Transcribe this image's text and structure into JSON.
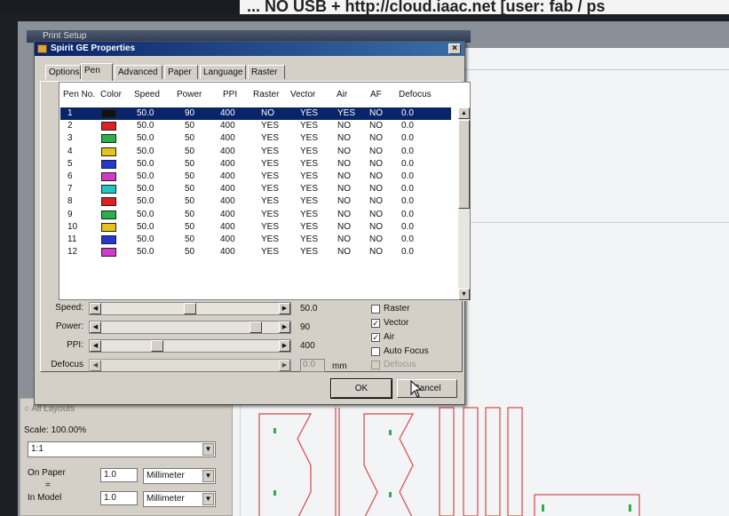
{
  "top_strip": {
    "text": "... NO USB + http://cloud.iaac.net [user: fab / ps"
  },
  "print_setup": {
    "title": "Print Setup"
  },
  "dialog": {
    "title": "Spirit GE Properties",
    "close_symbol": "×",
    "tabs": [
      {
        "label": "Options",
        "active": false
      },
      {
        "label": "Pen",
        "active": true
      },
      {
        "label": "Advanced",
        "active": false
      },
      {
        "label": "Paper",
        "active": false
      },
      {
        "label": "Language",
        "active": false
      },
      {
        "label": "Raster",
        "active": false
      }
    ],
    "table": {
      "headers": [
        "Pen No.",
        "Color",
        "Speed",
        "Power",
        "PPI",
        "Raster",
        "Vector",
        "Air",
        "AF",
        "Defocus"
      ],
      "rows": [
        {
          "pen": "1",
          "color": "#111111",
          "speed": "50.0",
          "power": "90",
          "ppi": "400",
          "raster": "NO",
          "vector": "YES",
          "air": "YES",
          "af": "NO",
          "defocus": "0.0",
          "selected": true
        },
        {
          "pen": "2",
          "color": "#e02020",
          "speed": "50.0",
          "power": "50",
          "ppi": "400",
          "raster": "YES",
          "vector": "YES",
          "air": "NO",
          "af": "NO",
          "defocus": "0.0",
          "selected": false
        },
        {
          "pen": "3",
          "color": "#2ab04a",
          "speed": "50.0",
          "power": "50",
          "ppi": "400",
          "raster": "YES",
          "vector": "YES",
          "air": "NO",
          "af": "NO",
          "defocus": "0.0",
          "selected": false
        },
        {
          "pen": "4",
          "color": "#e6c21a",
          "speed": "50.0",
          "power": "50",
          "ppi": "400",
          "raster": "YES",
          "vector": "YES",
          "air": "NO",
          "af": "NO",
          "defocus": "0.0",
          "selected": false
        },
        {
          "pen": "5",
          "color": "#2438d0",
          "speed": "50.0",
          "power": "50",
          "ppi": "400",
          "raster": "YES",
          "vector": "YES",
          "air": "NO",
          "af": "NO",
          "defocus": "0.0",
          "selected": false
        },
        {
          "pen": "6",
          "color": "#d23ac8",
          "speed": "50.0",
          "power": "50",
          "ppi": "400",
          "raster": "YES",
          "vector": "YES",
          "air": "NO",
          "af": "NO",
          "defocus": "0.0",
          "selected": false
        },
        {
          "pen": "7",
          "color": "#22c4c4",
          "speed": "50.0",
          "power": "50",
          "ppi": "400",
          "raster": "YES",
          "vector": "YES",
          "air": "NO",
          "af": "NO",
          "defocus": "0.0",
          "selected": false
        },
        {
          "pen": "8",
          "color": "#e02020",
          "speed": "50.0",
          "power": "50",
          "ppi": "400",
          "raster": "YES",
          "vector": "YES",
          "air": "NO",
          "af": "NO",
          "defocus": "0.0",
          "selected": false
        },
        {
          "pen": "9",
          "color": "#2ab04a",
          "speed": "50.0",
          "power": "50",
          "ppi": "400",
          "raster": "YES",
          "vector": "YES",
          "air": "NO",
          "af": "NO",
          "defocus": "0.0",
          "selected": false
        },
        {
          "pen": "10",
          "color": "#e6c21a",
          "speed": "50.0",
          "power": "50",
          "ppi": "400",
          "raster": "YES",
          "vector": "YES",
          "air": "NO",
          "af": "NO",
          "defocus": "0.0",
          "selected": false
        },
        {
          "pen": "11",
          "color": "#2438d0",
          "speed": "50.0",
          "power": "50",
          "ppi": "400",
          "raster": "YES",
          "vector": "YES",
          "air": "NO",
          "af": "NO",
          "defocus": "0.0",
          "selected": false
        },
        {
          "pen": "12",
          "color": "#d23ac8",
          "speed": "50.0",
          "power": "50",
          "ppi": "400",
          "raster": "YES",
          "vector": "YES",
          "air": "NO",
          "af": "NO",
          "defocus": "0.0",
          "selected": false
        }
      ]
    },
    "sliders": [
      {
        "label": "Speed:",
        "value": "50.0",
        "level": 0.5,
        "enabled": true
      },
      {
        "label": "Power:",
        "value": "90",
        "level": 0.9,
        "enabled": true
      },
      {
        "label": "PPI:",
        "value": "400",
        "level": 0.3,
        "enabled": true
      },
      {
        "label": "Defocus",
        "value": "0.0",
        "level": 0.0,
        "enabled": false,
        "unit": "mm"
      }
    ],
    "checkboxes": [
      {
        "label": "Raster",
        "checked": false,
        "enabled": true
      },
      {
        "label": "Vector",
        "checked": true,
        "enabled": true
      },
      {
        "label": "Air",
        "checked": true,
        "enabled": true
      },
      {
        "label": "Auto Focus",
        "checked": false,
        "enabled": true
      },
      {
        "label": "Defocus",
        "checked": false,
        "enabled": false
      }
    ],
    "ok_label": "OK",
    "cancel_label": "Cancel"
  },
  "left_panel": {
    "all_layouts_label": "All Layouts",
    "scale_label": "Scale: 100.00%",
    "scale_combo": "1:1",
    "on_paper_label": "On Paper",
    "equals": "=",
    "in_model_label": "In Model",
    "on_paper_value": "1.0",
    "in_model_value": "1.0",
    "on_paper_unit": "Millimeter",
    "in_model_unit": "Millimeter"
  },
  "colors": {
    "titlebar": "#0a246a",
    "selection": "#0a246a",
    "dialog_face": "#d4d0c8",
    "cad_lines": "#d94848"
  }
}
